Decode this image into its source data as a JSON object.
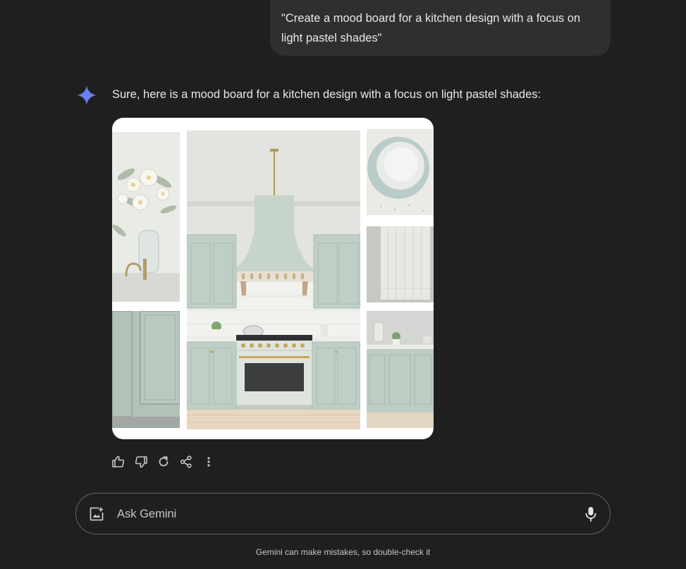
{
  "prompt": {
    "text": "\"Create a mood board for a kitchen design with a focus on light pastel shades\""
  },
  "response": {
    "text": "Sure, here is a mood board for a kitchen design with a focus on light pastel shades:",
    "assistant_icon": "gemini-sparkle-icon",
    "image_tiles": [
      "floral-wallpaper-vase",
      "kitchen-range-hood-stove",
      "pastel-plates",
      "linen-tea-towel",
      "sage-cabinet-door",
      "pastel-kitchen-counter"
    ]
  },
  "actions": [
    {
      "name": "thumbs-up-icon"
    },
    {
      "name": "thumbs-down-icon"
    },
    {
      "name": "regenerate-icon"
    },
    {
      "name": "share-icon"
    },
    {
      "name": "more-options-icon"
    }
  ],
  "input": {
    "placeholder": "Ask Gemini",
    "value": "",
    "image_button_icon": "add-image-icon",
    "mic_icon": "microphone-icon"
  },
  "footer": {
    "disclaimer": "Gemini can make mistakes, so double-check it"
  },
  "colors": {
    "background": "#1f1f20",
    "bubble": "#2e2f31",
    "text": "#e3e3e3",
    "sage": "#b8c7bd",
    "brass": "#c9a45c"
  }
}
